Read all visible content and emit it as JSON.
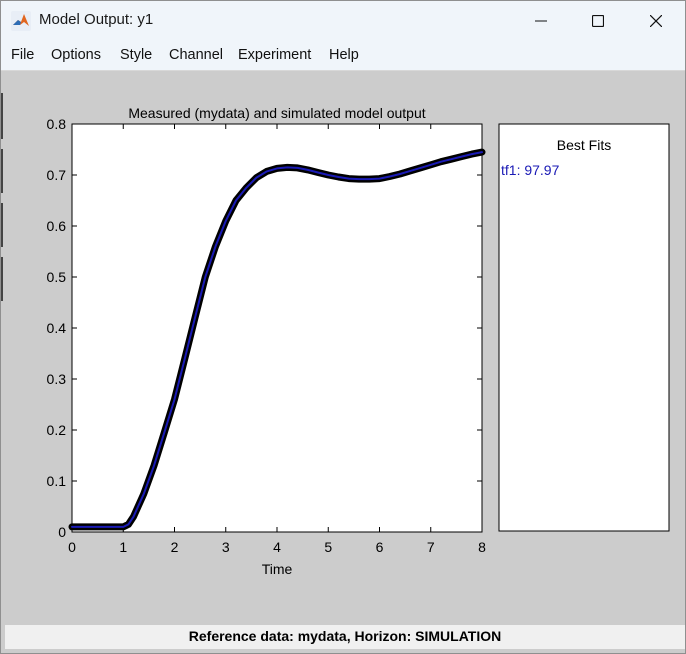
{
  "window": {
    "title": "Model Output: y1"
  },
  "menu": [
    {
      "label": "File"
    },
    {
      "label": "Options"
    },
    {
      "label": "Style"
    },
    {
      "label": "Channel"
    },
    {
      "label": "Experiment"
    },
    {
      "label": "Help"
    }
  ],
  "chart_data": {
    "type": "line",
    "title": "Measured (mydata) and simulated model output",
    "xlabel": "Time",
    "ylabel": "",
    "xlim": [
      0,
      8
    ],
    "ylim": [
      0,
      0.8
    ],
    "xticks": [
      "0",
      "1",
      "2",
      "3",
      "4",
      "5",
      "6",
      "7",
      "8"
    ],
    "yticks": [
      "0",
      "0.1",
      "0.2",
      "0.3",
      "0.4",
      "0.5",
      "0.6",
      "0.7",
      "0.8"
    ],
    "grid": false,
    "series": [
      {
        "color": "#000000",
        "x": [
          0,
          0.5,
          1.0,
          1.1,
          1.2,
          1.4,
          1.6,
          1.8,
          2.0,
          2.2,
          2.4,
          2.6,
          2.8,
          3.0,
          3.2,
          3.4,
          3.6,
          3.8,
          4.0,
          4.2,
          4.4,
          4.6,
          4.8,
          5.0,
          5.2,
          5.4,
          5.6,
          5.8,
          6.0,
          6.2,
          6.4,
          6.6,
          6.8,
          7.0,
          7.2,
          7.4,
          7.6,
          7.8,
          8.0
        ],
        "y": [
          0.01,
          0.01,
          0.01,
          0.015,
          0.03,
          0.075,
          0.13,
          0.195,
          0.26,
          0.34,
          0.42,
          0.5,
          0.56,
          0.61,
          0.65,
          0.675,
          0.695,
          0.707,
          0.713,
          0.715,
          0.714,
          0.71,
          0.705,
          0.7,
          0.696,
          0.693,
          0.692,
          0.692,
          0.693,
          0.697,
          0.702,
          0.708,
          0.714,
          0.72,
          0.726,
          0.731,
          0.736,
          0.741,
          0.745
        ]
      },
      {
        "color": "#1a1ab5",
        "x": [
          0,
          0.5,
          1.0,
          1.1,
          1.2,
          1.4,
          1.6,
          1.8,
          2.0,
          2.2,
          2.4,
          2.6,
          2.8,
          3.0,
          3.2,
          3.4,
          3.6,
          3.8,
          4.0,
          4.2,
          4.4,
          4.6,
          4.8,
          5.0,
          5.2,
          5.4,
          5.6,
          5.8,
          6.0,
          6.2,
          6.4,
          6.6,
          6.8,
          7.0,
          7.2,
          7.4,
          7.6,
          7.8,
          8.0
        ],
        "y": [
          0.01,
          0.01,
          0.01,
          0.015,
          0.03,
          0.075,
          0.13,
          0.195,
          0.26,
          0.34,
          0.42,
          0.5,
          0.56,
          0.61,
          0.65,
          0.675,
          0.695,
          0.707,
          0.713,
          0.715,
          0.714,
          0.71,
          0.705,
          0.7,
          0.696,
          0.693,
          0.692,
          0.692,
          0.693,
          0.697,
          0.702,
          0.708,
          0.714,
          0.72,
          0.726,
          0.731,
          0.736,
          0.741,
          0.745
        ]
      }
    ]
  },
  "best_fits": {
    "title": "Best Fits",
    "entries": [
      {
        "label": "tf1: 97.97",
        "color": "#1a1ab5"
      }
    ]
  },
  "status": {
    "text": "Reference data:  mydata, Horizon: SIMULATION"
  }
}
